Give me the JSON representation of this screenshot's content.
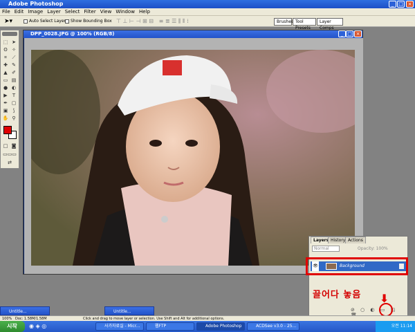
{
  "app": {
    "title": "Adobe Photoshop"
  },
  "menu": [
    "File",
    "Edit",
    "Image",
    "Layer",
    "Select",
    "Filter",
    "View",
    "Window",
    "Help"
  ],
  "options": {
    "auto_select": "Auto Select Layer",
    "show_bbox": "Show Bounding Box"
  },
  "palette_well": {
    "tabs": [
      "Brushes",
      "Tool Presets",
      "Layer Comps"
    ]
  },
  "document": {
    "title": "DPP_0028.JPG @ 100% (RGB/8)"
  },
  "layers_panel": {
    "tabs": [
      "Layers",
      "History",
      "Actions"
    ],
    "mode": "Normal",
    "opacity_label": "Opacity: 100%",
    "layer_name": "Background"
  },
  "annotation": {
    "text": "끌어다 놓음",
    "color": "#d40000"
  },
  "minimized": [
    {
      "label": "Untitle..."
    },
    {
      "label": "Untitle..."
    }
  ],
  "status": {
    "zoom": "100%",
    "doc": "Doc: 1.58M/1.58M",
    "hint": "Click and drag to move layer or selection.  Use Shift and Alt for additional options."
  },
  "taskbar": {
    "start": "시작",
    "items": [
      "사가자료실 - Micr...",
      "웹FTP",
      "Adobe Photoshop",
      "ACDSee v3.0 - 25..."
    ],
    "clock": "오전 11:14"
  },
  "colors": {
    "foreground": "#e00000",
    "background": "#ffffff",
    "selection": "#3169c6",
    "highlight": "#e00000"
  }
}
